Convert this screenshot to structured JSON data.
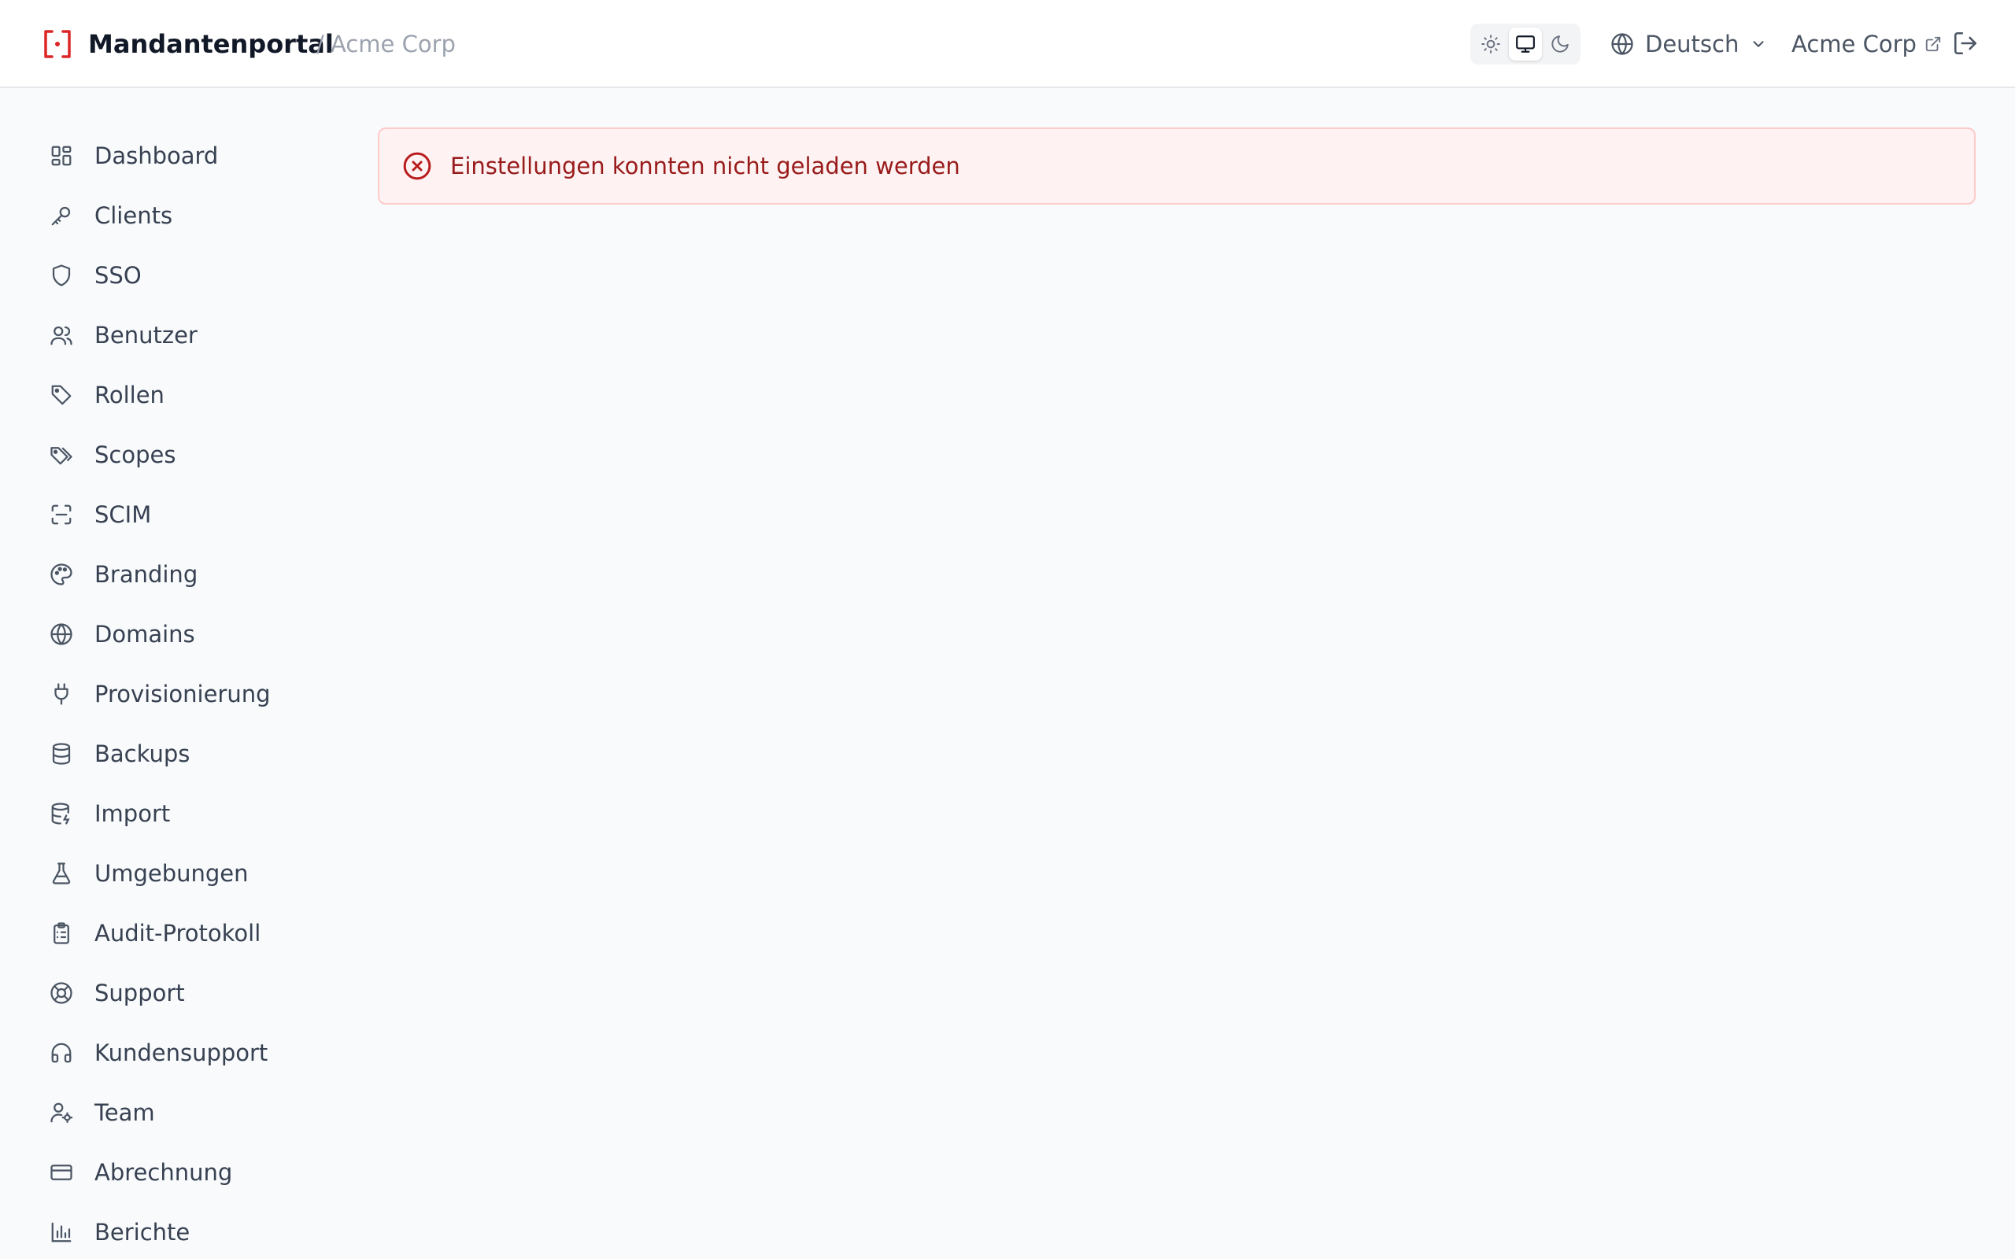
{
  "header": {
    "brand_title": "Mandantenportal",
    "breadcrumb_separator": "/",
    "tenant_name": "Acme Corp",
    "language_label": "Deutsch",
    "tenant_link_label": "Acme Corp",
    "theme_options": [
      "light",
      "system",
      "dark"
    ],
    "theme_selected": "system"
  },
  "sidebar": {
    "items": [
      {
        "label": "Dashboard",
        "icon": "dashboard-icon"
      },
      {
        "label": "Clients",
        "icon": "key-icon"
      },
      {
        "label": "SSO",
        "icon": "shield-icon"
      },
      {
        "label": "Benutzer",
        "icon": "users-icon"
      },
      {
        "label": "Rollen",
        "icon": "tag-icon"
      },
      {
        "label": "Scopes",
        "icon": "tags-icon"
      },
      {
        "label": "SCIM",
        "icon": "scan-icon"
      },
      {
        "label": "Branding",
        "icon": "palette-icon"
      },
      {
        "label": "Domains",
        "icon": "globe-icon"
      },
      {
        "label": "Provisionierung",
        "icon": "plug-icon"
      },
      {
        "label": "Backups",
        "icon": "database-icon"
      },
      {
        "label": "Import",
        "icon": "database-import-icon"
      },
      {
        "label": "Umgebungen",
        "icon": "flask-icon"
      },
      {
        "label": "Audit-Protokoll",
        "icon": "clipboard-icon"
      },
      {
        "label": "Support",
        "icon": "life-buoy-icon"
      },
      {
        "label": "Kundensupport",
        "icon": "headphones-icon"
      },
      {
        "label": "Team",
        "icon": "user-cog-icon"
      },
      {
        "label": "Abrechnung",
        "icon": "credit-card-icon"
      },
      {
        "label": "Berichte",
        "icon": "bar-chart-icon"
      }
    ]
  },
  "alert": {
    "message": "Einstellungen konnten nicht geladen werden",
    "icon": "error-circle-icon"
  },
  "colors": {
    "brand_accent": "#dc2626",
    "alert_background": "#fef2f2",
    "alert_border": "#fecaca",
    "alert_text": "#991b1b"
  }
}
